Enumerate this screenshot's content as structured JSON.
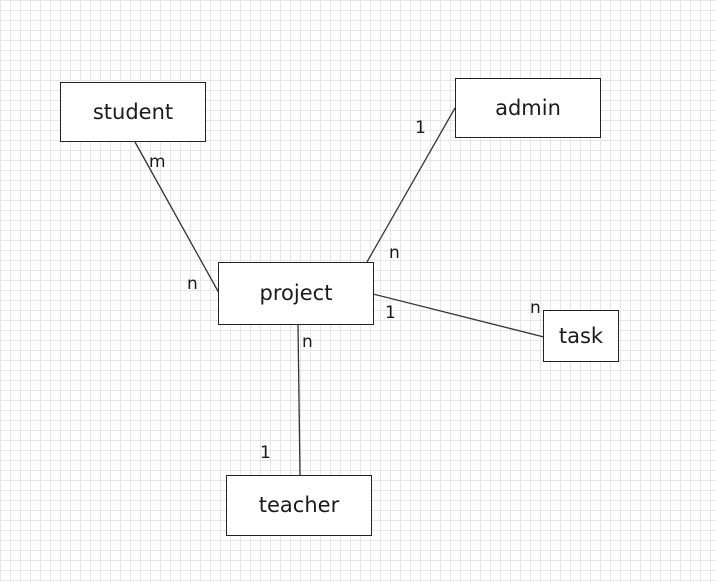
{
  "entities": {
    "student": "student",
    "admin": "admin",
    "project": "project",
    "task": "task",
    "teacher": "teacher"
  },
  "relationships": [
    {
      "from": "student",
      "to": "project",
      "from_card": "m",
      "to_card": "n"
    },
    {
      "from": "admin",
      "to": "project",
      "from_card": "1",
      "to_card": "n"
    },
    {
      "from": "project",
      "to": "task",
      "from_card": "1",
      "to_card": "n"
    },
    {
      "from": "project",
      "to": "teacher",
      "from_card": "n",
      "to_card": "1"
    }
  ]
}
